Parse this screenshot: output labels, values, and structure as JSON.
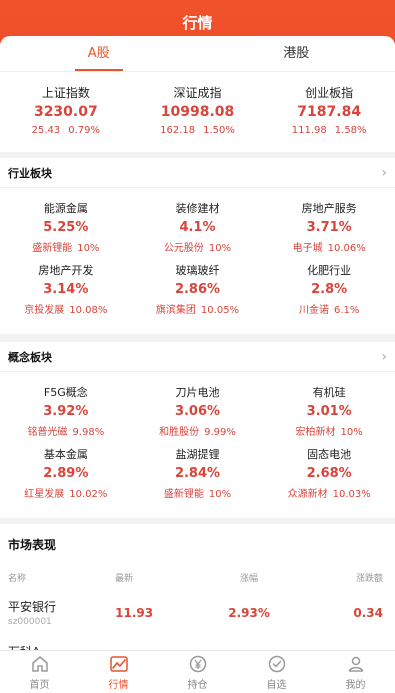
{
  "header": {
    "title": "行情"
  },
  "tabs": [
    {
      "label": "A股",
      "active": true
    },
    {
      "label": "港股",
      "active": false
    }
  ],
  "indices": [
    {
      "name": "上证指数",
      "value": "3230.07",
      "change": "25.43",
      "pct": "0.79%"
    },
    {
      "name": "深证成指",
      "value": "10998.08",
      "change": "162.18",
      "pct": "1.50%"
    },
    {
      "name": "创业板指",
      "value": "7187.84",
      "change": "111.98",
      "pct": "1.58%"
    }
  ],
  "industry": {
    "title": "行业板块",
    "items": [
      {
        "name": "能源金属",
        "pct": "5.25%",
        "lead": "盛新锂能",
        "lead_pct": "10%"
      },
      {
        "name": "装修建材",
        "pct": "4.1%",
        "lead": "公元股份",
        "lead_pct": "10%"
      },
      {
        "name": "房地产服务",
        "pct": "3.71%",
        "lead": "电子城",
        "lead_pct": "10.06%"
      },
      {
        "name": "房地产开发",
        "pct": "3.14%",
        "lead": "京投发展",
        "lead_pct": "10.08%"
      },
      {
        "name": "玻璃玻纤",
        "pct": "2.86%",
        "lead": "旗滨集团",
        "lead_pct": "10.05%"
      },
      {
        "name": "化肥行业",
        "pct": "2.8%",
        "lead": "川金诺",
        "lead_pct": "6.1%"
      }
    ]
  },
  "concept": {
    "title": "概念板块",
    "items": [
      {
        "name": "F5G概念",
        "pct": "3.92%",
        "lead": "铭普光磁",
        "lead_pct": "9.98%"
      },
      {
        "name": "刀片电池",
        "pct": "3.06%",
        "lead": "和胜股份",
        "lead_pct": "9.99%"
      },
      {
        "name": "有机硅",
        "pct": "3.01%",
        "lead": "宏柏新材",
        "lead_pct": "10%"
      },
      {
        "name": "基本金属",
        "pct": "2.89%",
        "lead": "红星发展",
        "lead_pct": "10.02%"
      },
      {
        "name": "盐湖提锂",
        "pct": "2.84%",
        "lead": "盛新锂能",
        "lead_pct": "10%"
      },
      {
        "name": "固态电池",
        "pct": "2.68%",
        "lead": "众源新材",
        "lead_pct": "10.03%"
      }
    ]
  },
  "market": {
    "title": "市场表现",
    "columns": [
      "名称",
      "最新",
      "涨幅",
      "涨跌额"
    ],
    "rows": [
      {
        "name": "平安银行",
        "code": "sz000001",
        "latest": "11.93",
        "pct": "2.93%",
        "change": "0.34"
      }
    ],
    "partial_row": "万科A"
  },
  "nav": [
    {
      "label": "首页",
      "icon": "home-icon",
      "active": false
    },
    {
      "label": "行情",
      "icon": "chart-icon",
      "active": true
    },
    {
      "label": "持仓",
      "icon": "yuan-icon",
      "active": false
    },
    {
      "label": "自选",
      "icon": "check-icon",
      "active": false
    },
    {
      "label": "我的",
      "icon": "user-icon",
      "active": false
    }
  ],
  "colors": {
    "accent": "#ef4e2a",
    "up": "#d9443b",
    "muted": "#888888"
  }
}
